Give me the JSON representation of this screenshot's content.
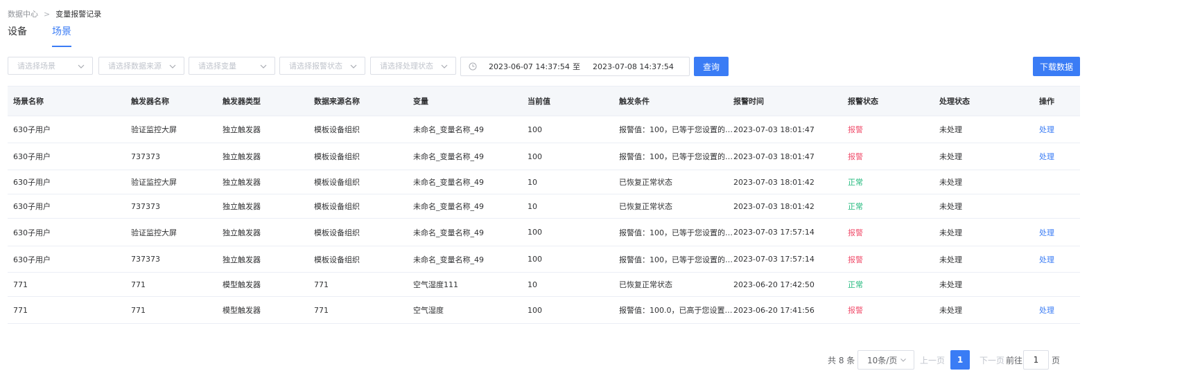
{
  "breadcrumb": {
    "root": "数据中心",
    "separator": ">",
    "current": "变量报警记录"
  },
  "tabs": [
    {
      "label": "设备",
      "active": false
    },
    {
      "label": "场景",
      "active": true
    }
  ],
  "filters": {
    "scene_placeholder": "请选择场景",
    "source_placeholder": "请选择数据来源",
    "variable_placeholder": "请选择变量",
    "alarm_status_placeholder": "请选择报警状态",
    "process_status_placeholder": "请选择处理状态",
    "date_start": "2023-06-07 14:37:54",
    "date_separator": "至",
    "date_end": "2023-07-08 14:37:54",
    "query_label": "查询",
    "download_label": "下载数据"
  },
  "table": {
    "headers": [
      "场景名称",
      "触发器名称",
      "触发器类型",
      "数据来源名称",
      "变量",
      "当前值",
      "触发条件",
      "报警时间",
      "报警状态",
      "处理状态",
      "操作"
    ],
    "rows": [
      [
        "630子用户",
        "验证监控大屏",
        "独立触发器",
        "模板设备组织",
        "未命名_变量名称_49",
        "100",
        "报警值：100，已等于您设置的…",
        "2023-07-03 18:01:47",
        "报警",
        "未处理",
        "处理"
      ],
      [
        "630子用户",
        "737373",
        "独立触发器",
        "模板设备组织",
        "未命名_变量名称_49",
        "100",
        "报警值：100，已等于您设置的…",
        "2023-07-03 18:01:47",
        "报警",
        "未处理",
        "处理"
      ],
      [
        "630子用户",
        "验证监控大屏",
        "独立触发器",
        "模板设备组织",
        "未命名_变量名称_49",
        "10",
        "已恢复正常状态",
        "2023-07-03 18:01:42",
        "正常",
        "未处理",
        ""
      ],
      [
        "630子用户",
        "737373",
        "独立触发器",
        "模板设备组织",
        "未命名_变量名称_49",
        "10",
        "已恢复正常状态",
        "2023-07-03 18:01:42",
        "正常",
        "未处理",
        ""
      ],
      [
        "630子用户",
        "验证监控大屏",
        "独立触发器",
        "模板设备组织",
        "未命名_变量名称_49",
        "100",
        "报警值：100，已等于您设置的…",
        "2023-07-03 17:57:14",
        "报警",
        "未处理",
        "处理"
      ],
      [
        "630子用户",
        "737373",
        "独立触发器",
        "模板设备组织",
        "未命名_变量名称_49",
        "100",
        "报警值：100，已等于您设置的…",
        "2023-07-03 17:57:14",
        "报警",
        "未处理",
        "处理"
      ],
      [
        "771",
        "771",
        "模型触发器",
        "771",
        "空气湿度111",
        "10",
        "已恢复正常状态",
        "2023-06-20 17:42:50",
        "正常",
        "未处理",
        ""
      ],
      [
        "771",
        "771",
        "模型触发器",
        "771",
        "空气湿度",
        "100",
        "报警值：100.0，已高于您设置…",
        "2023-06-20 17:41:56",
        "报警",
        "未处理",
        "处理"
      ]
    ]
  },
  "status_colors": {
    "报警": "#f0506e",
    "正常": "#21b87c"
  },
  "pagination": {
    "total": "共 8 条",
    "page_size": "10条/页",
    "prev": "上一页",
    "current_page": "1",
    "next": "下一页",
    "goto_label": "前往",
    "goto_value": "1",
    "page_suffix": "页"
  },
  "accent_color": "#3a7cf5"
}
